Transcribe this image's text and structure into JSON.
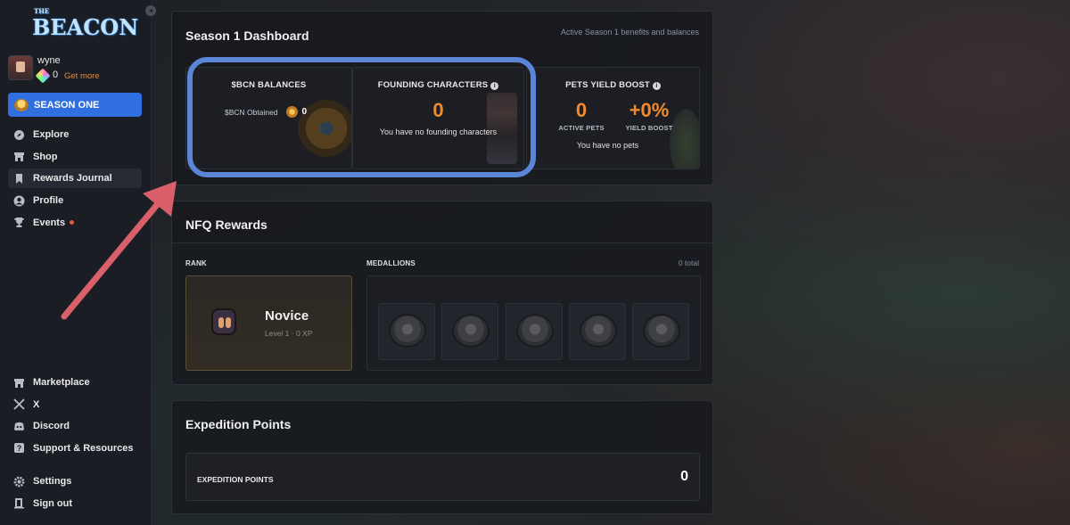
{
  "brand": {
    "the": "THE",
    "name": "BEACON"
  },
  "user": {
    "name": "wyne",
    "gem_count": "0",
    "get_more": "Get more"
  },
  "season_button": "SEASON ONE",
  "nav": [
    {
      "label": "Explore",
      "icon": "compass-icon"
    },
    {
      "label": "Shop",
      "icon": "store-icon"
    },
    {
      "label": "Rewards Journal",
      "icon": "bookmark-icon"
    },
    {
      "label": "Profile",
      "icon": "user-icon"
    },
    {
      "label": "Events",
      "icon": "trophy-icon"
    }
  ],
  "bottom_nav": [
    {
      "label": "Marketplace",
      "icon": "store-icon"
    },
    {
      "label": "X",
      "icon": "x-icon"
    },
    {
      "label": "Discord",
      "icon": "discord-icon"
    },
    {
      "label": "Support & Resources",
      "icon": "help-icon"
    }
  ],
  "bottom_nav2": [
    {
      "label": "Settings",
      "icon": "gear-icon"
    },
    {
      "label": "Sign out",
      "icon": "signout-icon"
    }
  ],
  "dashboard": {
    "title": "Season 1 Dashboard",
    "subtitle": "Active Season 1 benefits and balances",
    "bcn": {
      "title": "$BCN BALANCES",
      "obtained_label": "$BCN Obtained",
      "obtained_value": "0"
    },
    "founding": {
      "title": "FOUNDING CHARACTERS",
      "value": "0",
      "message": "You have no founding characters"
    },
    "pets": {
      "title": "PETS YIELD BOOST",
      "active_value": "0",
      "active_label": "ACTIVE PETS",
      "boost_value": "+0%",
      "boost_label": "YIELD BOOST",
      "message": "You have no pets"
    }
  },
  "nfq": {
    "title": "NFQ Rewards",
    "rank_label": "RANK",
    "rank_name": "Novice",
    "rank_level": "Level 1 · 0 XP",
    "medallions_label": "MEDALLIONS",
    "medallions_total": "0 total",
    "medallion_slots": 5
  },
  "expedition": {
    "title": "Expedition Points",
    "label": "EXPEDITION POINTS",
    "value": "0"
  },
  "colors": {
    "accent_blue": "#2f6fe0",
    "accent_orange": "#f08a2c",
    "highlight": "#5b86d8",
    "arrow": "#d9606a"
  }
}
